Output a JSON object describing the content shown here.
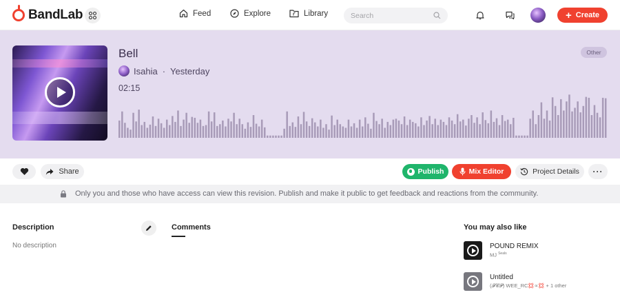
{
  "brand": {
    "name": "BandLab",
    "accent": "#f0412f"
  },
  "nav": {
    "feed": "Feed",
    "explore": "Explore",
    "library": "Library",
    "search_placeholder": "Search",
    "create": "Create"
  },
  "track": {
    "title": "Bell",
    "artist": "Isahia",
    "separator": "·",
    "posted": "Yesterday",
    "duration": "02:15",
    "genre": "Other",
    "waveform": [
      0.38,
      0.58,
      0.33,
      0.22,
      0.18,
      0.55,
      0.36,
      0.62,
      0.28,
      0.35,
      0.22,
      0.29,
      0.47,
      0.26,
      0.42,
      0.32,
      0.22,
      0.4,
      0.28,
      0.48,
      0.35,
      0.6,
      0.26,
      0.4,
      0.55,
      0.33,
      0.46,
      0.44,
      0.33,
      0.4,
      0.26,
      0.28,
      0.58,
      0.36,
      0.56,
      0.26,
      0.3,
      0.38,
      0.25,
      0.42,
      0.36,
      0.55,
      0.3,
      0.42,
      0.3,
      0.2,
      0.34,
      0.24,
      0.5,
      0.31,
      0.25,
      0.4,
      0.23,
      0.05,
      0.05,
      0.05,
      0.05,
      0.05,
      0.05,
      0.2,
      0.58,
      0.26,
      0.34,
      0.24,
      0.47,
      0.3,
      0.57,
      0.36,
      0.26,
      0.43,
      0.34,
      0.25,
      0.4,
      0.22,
      0.3,
      0.18,
      0.49,
      0.28,
      0.4,
      0.3,
      0.25,
      0.22,
      0.4,
      0.25,
      0.32,
      0.22,
      0.4,
      0.25,
      0.45,
      0.31,
      0.2,
      0.55,
      0.37,
      0.3,
      0.42,
      0.22,
      0.35,
      0.28,
      0.4,
      0.42,
      0.38,
      0.3,
      0.47,
      0.28,
      0.4,
      0.35,
      0.32,
      0.25,
      0.45,
      0.28,
      0.38,
      0.48,
      0.3,
      0.42,
      0.28,
      0.4,
      0.35,
      0.28,
      0.45,
      0.38,
      0.3,
      0.52,
      0.36,
      0.4,
      0.27,
      0.42,
      0.5,
      0.33,
      0.45,
      0.3,
      0.56,
      0.39,
      0.32,
      0.6,
      0.35,
      0.43,
      0.28,
      0.5,
      0.37,
      0.4,
      0.3,
      0.44,
      0.05,
      0.05,
      0.05,
      0.05,
      0.05,
      0.42,
      0.6,
      0.3,
      0.5,
      0.78,
      0.42,
      0.6,
      0.38,
      0.89,
      0.7,
      0.5,
      0.85,
      0.6,
      0.8,
      0.95,
      0.58,
      0.66,
      0.8,
      0.56,
      0.7,
      0.9,
      0.88,
      0.5,
      0.72,
      0.55,
      0.45,
      0.88,
      0.87
    ]
  },
  "actions": {
    "share": "Share",
    "publish": "Publish",
    "mix_editor": "Mix Editor",
    "project_details": "Project Details",
    "more": "···"
  },
  "notice": "Only you and those who have access can view this revision. Publish and make it public to get feedback and reactions from the community.",
  "description": {
    "title": "Description",
    "text": "No description"
  },
  "comments": {
    "tab": "Comments"
  },
  "recommendations": {
    "title": "You may also like",
    "items": [
      {
        "title": "POUND REMIX",
        "subtitle": "MJ",
        "badge": "Seals",
        "thumb_color": "#1a1a1a"
      },
      {
        "title": "Untitled",
        "subtitle": "(𝓕𝓒𝓟) WEE_RC💢∝💢 + 1 other",
        "badge": "",
        "thumb_color": "#77777e"
      }
    ]
  },
  "colors": {
    "hero_bg": "#e4dcef",
    "waveform": "#a89bb8",
    "publish": "#1fb56b",
    "mix_editor": "#f0412f"
  }
}
